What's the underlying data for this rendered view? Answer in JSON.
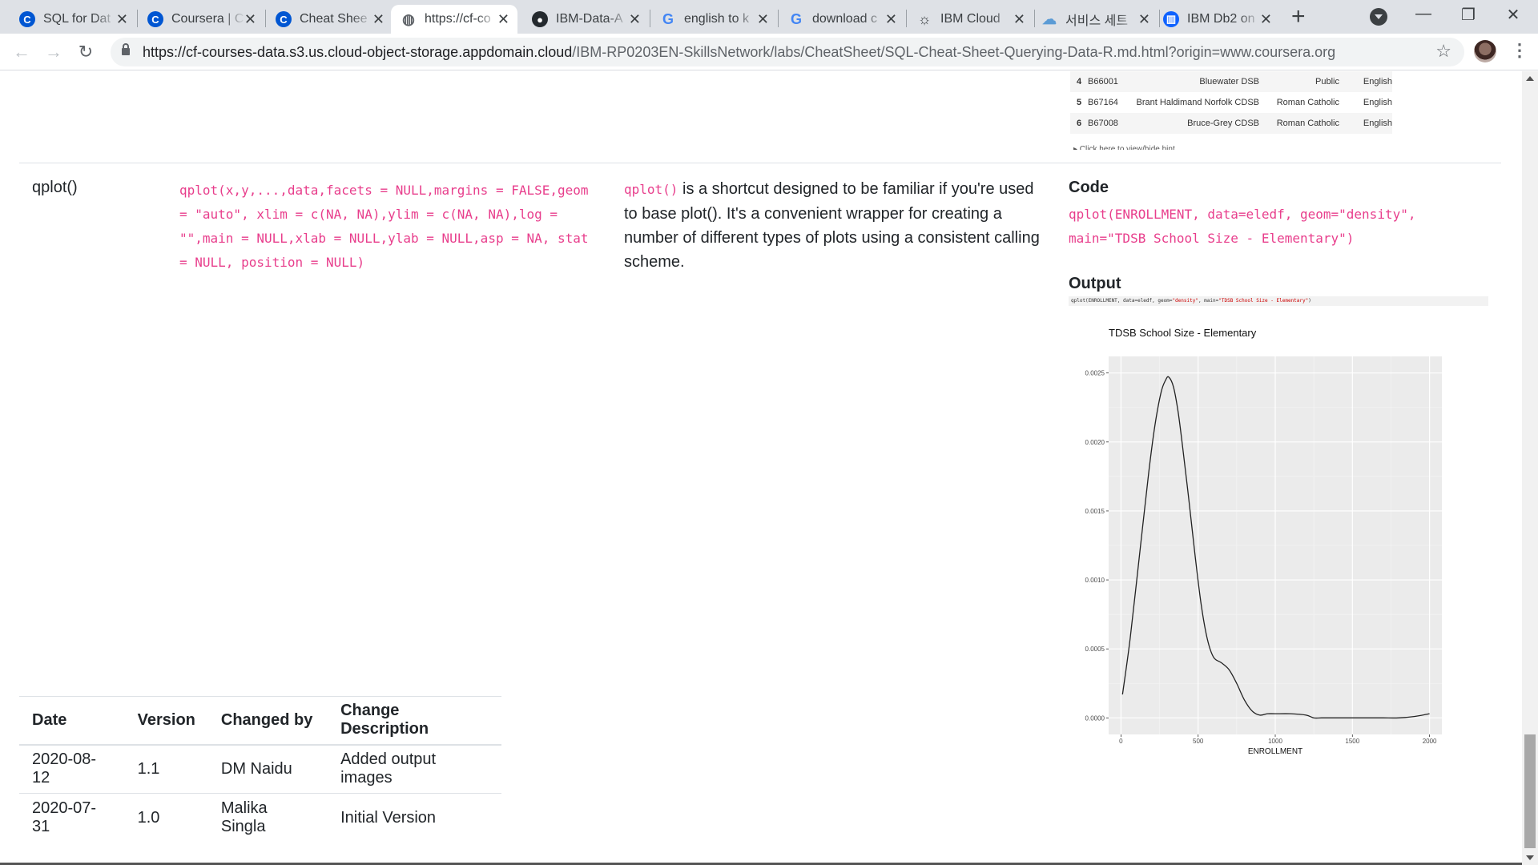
{
  "browser": {
    "tabs": [
      {
        "title": "SQL for Dat",
        "icon": "coursera-icon",
        "color": "#0056d2"
      },
      {
        "title": "Coursera | C",
        "icon": "coursera-icon",
        "color": "#0056d2"
      },
      {
        "title": "Cheat Shee",
        "icon": "coursera-icon",
        "color": "#0056d2"
      },
      {
        "title": "https://cf-co",
        "icon": "globe-icon",
        "color": "#5f6368",
        "active": true
      },
      {
        "title": "IBM-Data-A",
        "icon": "github-icon",
        "color": "#24292e"
      },
      {
        "title": "english to k",
        "icon": "google-icon",
        "color": "#4285f4"
      },
      {
        "title": "download c",
        "icon": "google-icon",
        "color": "#4285f4"
      },
      {
        "title": "IBM Cloud",
        "icon": "ibm-cloud-icon",
        "color": "#3c4043"
      },
      {
        "title": "서비스 세트",
        "icon": "cloud-icon",
        "color": "#5b9bd5"
      },
      {
        "title": "IBM Db2 on",
        "icon": "db2-icon",
        "color": "#0f62fe"
      }
    ],
    "url_host": "https://cf-courses-data.s3.us.cloud-object-storage.appdomain.cloud",
    "url_path": "/IBM-RP0203EN-SkillsNetwork/labs/CheatSheet/SQL-Cheat-Sheet-Querying-Data-R.md.html?origin=www.coursera.org"
  },
  "preview_table": {
    "rows": [
      {
        "idx": "4",
        "id": "B66001",
        "board": "Bluewater DSB",
        "type": "Public",
        "lang": "English"
      },
      {
        "idx": "5",
        "id": "B67164",
        "board": "Brant Haldimand Norfolk CDSB",
        "type": "Roman Catholic",
        "lang": "English"
      },
      {
        "idx": "6",
        "id": "B67008",
        "board": "Bruce-Grey CDSB",
        "type": "Roman Catholic",
        "lang": "English"
      }
    ],
    "hint": "▸ Click here to view/hide hint"
  },
  "entry": {
    "name": "qplot()",
    "syntax": "qplot(x,y,...,data,facets = NULL,margins = FALSE,geom = \"auto\", xlim = c(NA, NA),ylim = c(NA, NA),log = \"\",main = NULL,xlab = NULL,ylab = NULL,asp = NA, stat = NULL, position = NULL)",
    "desc_code": "qplot()",
    "desc_text": " is a shortcut designed to be familiar if you're used to base plot(). It's a convenient wrapper for creating a number of different types of plots using a consistent calling scheme.",
    "code_heading": "Code",
    "code": "qplot(ENROLLMENT, data=eledf, geom=\"density\", main=\"TDSB School Size - Elementary\")",
    "output_heading": "Output",
    "output_code_prefix": "qplot(ENROLLMENT, data=eledf, geom=",
    "output_code_geom": "\"density\"",
    "output_code_mid": ",  main=",
    "output_code_main": "\"TDSB School Size - Elementary\"",
    "output_code_suffix": ")"
  },
  "chart_data": {
    "type": "line",
    "title": "TDSB School Size - Elementary",
    "xlabel": "ENROLLMENT",
    "ylabel": "",
    "xlim": [
      -80,
      2080
    ],
    "ylim": [
      -0.00012,
      0.00262
    ],
    "xticks": [
      0,
      500,
      1000,
      1500,
      2000
    ],
    "xtick_labels": [
      "0",
      "500",
      "1000",
      "1500",
      "2000"
    ],
    "yticks": [
      0,
      0.0005,
      0.001,
      0.0015,
      0.002,
      0.0025
    ],
    "ytick_labels": [
      "0.0000",
      "0.0005",
      "0.0010",
      "0.0015",
      "0.0020",
      "0.0025"
    ],
    "background": "#ebebeb",
    "grid": true,
    "x": [
      10,
      60,
      120,
      180,
      220,
      260,
      290,
      310,
      340,
      370,
      400,
      440,
      480,
      520,
      560,
      600,
      650,
      700,
      750,
      800,
      850,
      900,
      950,
      1000,
      1100,
      1200,
      1250,
      1300,
      1400,
      1500,
      1600,
      1700,
      1800,
      1900,
      2000
    ],
    "y": [
      0.00017,
      0.00058,
      0.00118,
      0.00178,
      0.00212,
      0.00236,
      0.00245,
      0.00247,
      0.0024,
      0.00222,
      0.00196,
      0.00158,
      0.00118,
      0.00082,
      0.00057,
      0.00044,
      0.0004,
      0.00035,
      0.00025,
      0.00013,
      5e-05,
      2e-05,
      3e-05,
      3e-05,
      3e-05,
      2e-05,
      0.0,
      0.0,
      0.0,
      0.0,
      0.0,
      0.0,
      0.0,
      1e-05,
      3e-05
    ]
  },
  "changelog": {
    "headers": [
      "Date",
      "Version",
      "Changed by",
      "Change Description"
    ],
    "rows": [
      [
        "2020-08-12",
        "1.1",
        "DM Naidu",
        "Added output images"
      ],
      [
        "2020-07-31",
        "1.0",
        "Malika Singla",
        "Initial Version"
      ]
    ]
  }
}
